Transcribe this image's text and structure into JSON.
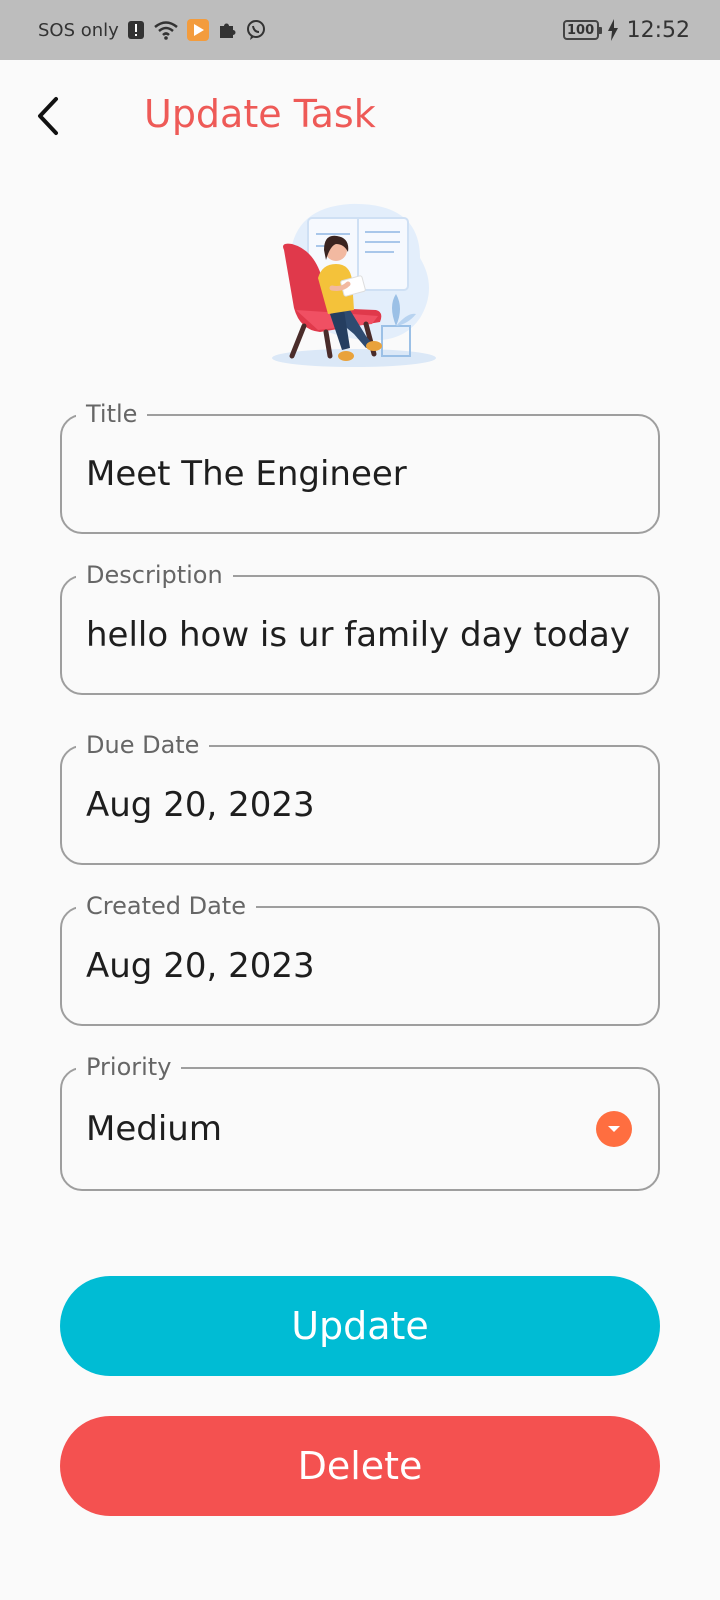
{
  "status_bar": {
    "sos_text": "SOS only",
    "battery": "100",
    "time": "12:52"
  },
  "header": {
    "title": "Update Task"
  },
  "form": {
    "title": {
      "label": "Title",
      "value": "Meet The Engineer"
    },
    "description": {
      "label": "Description",
      "value": "hello how is ur family day today si"
    },
    "due_date": {
      "label": "Due Date",
      "value": "Aug 20, 2023"
    },
    "created_date": {
      "label": "Created Date",
      "value": "Aug 20, 2023"
    },
    "priority": {
      "label": "Priority",
      "value": "Medium"
    }
  },
  "actions": {
    "update_label": "Update",
    "delete_label": "Delete"
  },
  "colors": {
    "title": "#ee5a57",
    "update_button": "#00bcd4",
    "delete_button": "#f45150",
    "dropdown_accent": "#ff6e40"
  }
}
